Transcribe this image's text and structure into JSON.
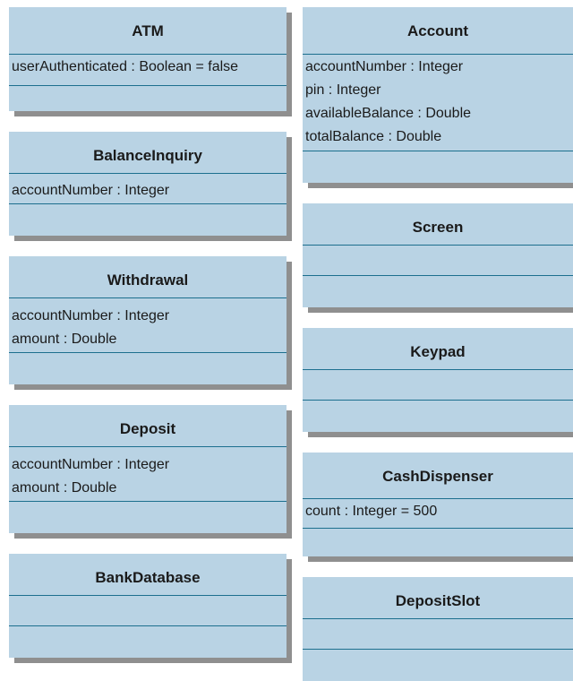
{
  "classes": [
    {
      "id": "atm",
      "name": "ATM",
      "attributes": [
        "userAuthenticated : Boolean = false"
      ]
    },
    {
      "id": "balance-inquiry",
      "name": "BalanceInquiry",
      "attributes": [
        "accountNumber : Integer"
      ]
    },
    {
      "id": "withdrawal",
      "name": "Withdrawal",
      "attributes": [
        "accountNumber : Integer",
        "amount : Double"
      ]
    },
    {
      "id": "deposit",
      "name": "Deposit",
      "attributes": [
        "accountNumber : Integer",
        "amount : Double"
      ]
    },
    {
      "id": "bank-database",
      "name": "BankDatabase",
      "attributes": []
    },
    {
      "id": "account",
      "name": "Account",
      "attributes": [
        "accountNumber : Integer",
        "pin : Integer",
        "availableBalance : Double",
        "totalBalance : Double"
      ]
    },
    {
      "id": "screen",
      "name": "Screen",
      "attributes": []
    },
    {
      "id": "keypad",
      "name": "Keypad",
      "attributes": []
    },
    {
      "id": "cash-dispenser",
      "name": "CashDispenser",
      "attributes": [
        "count : Integer = 500"
      ]
    },
    {
      "id": "deposit-slot",
      "name": "DepositSlot",
      "attributes": []
    }
  ]
}
